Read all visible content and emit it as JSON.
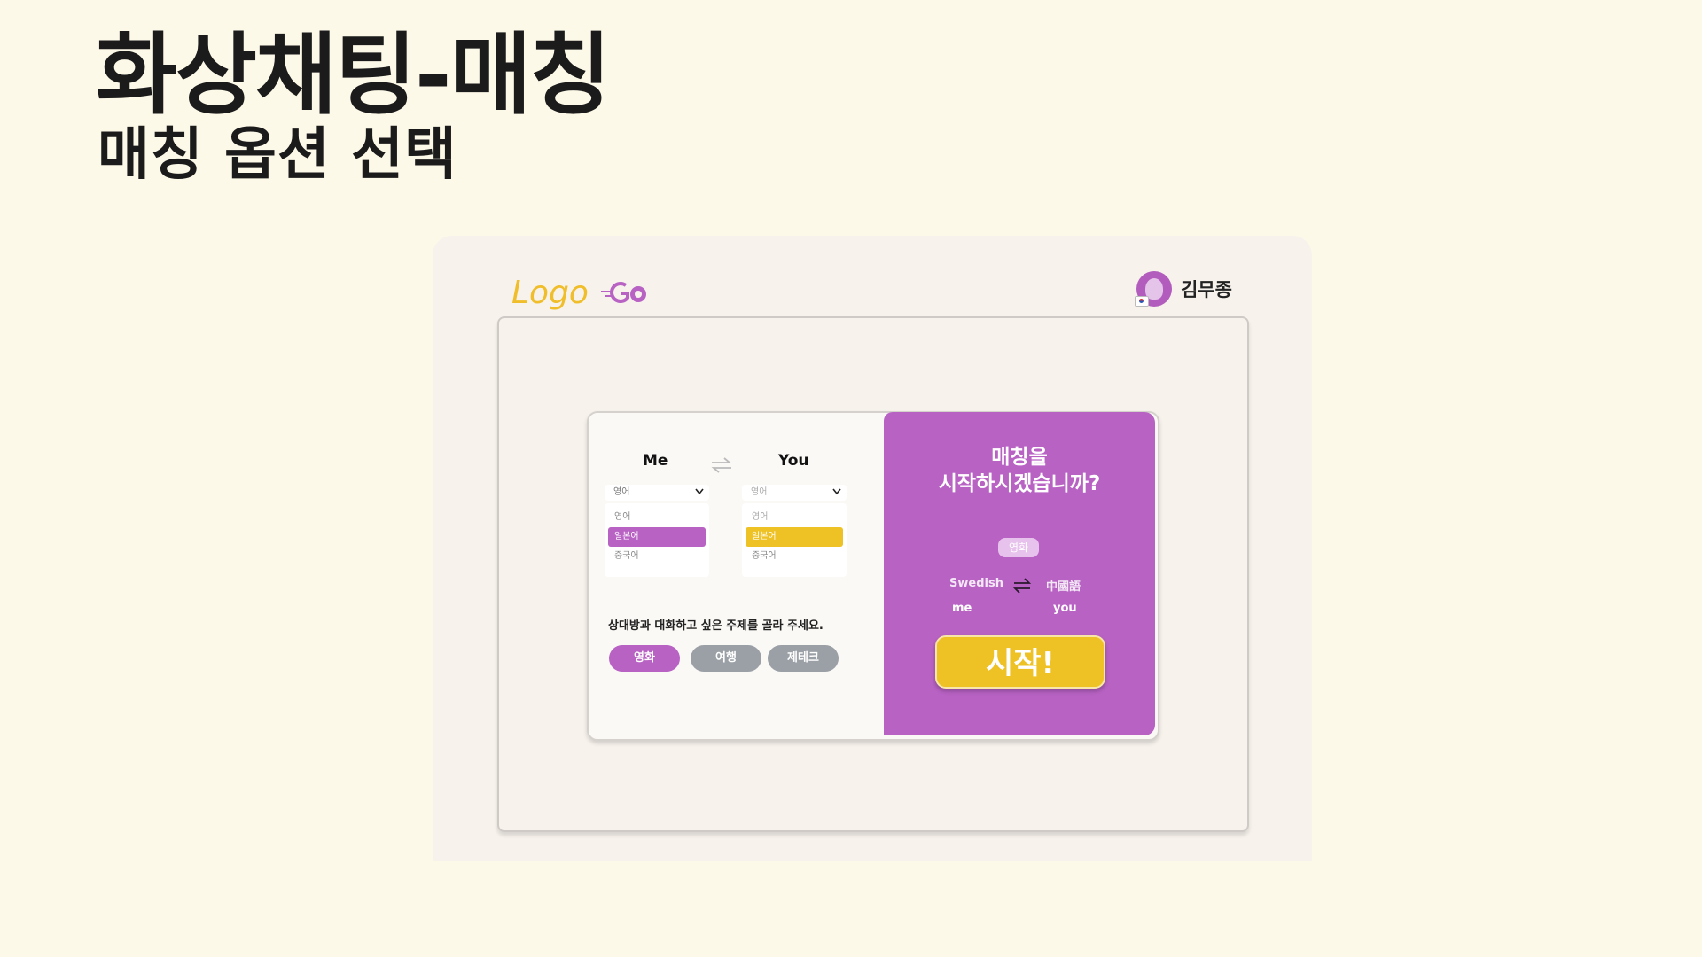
{
  "slide": {
    "title": "화상채팅-매칭",
    "subtitle": "매칭 옵션 선택"
  },
  "header": {
    "logo_text": "Logo",
    "logo_icon": "go-logo-icon",
    "user_name": "김무종",
    "avatar_icon": "user-avatar-icon"
  },
  "matching": {
    "me_label": "Me",
    "you_label": "You",
    "me_select": {
      "value": "영어",
      "options": [
        "영어",
        "일본어",
        "중국어"
      ],
      "highlighted": "일본어"
    },
    "you_select": {
      "value": "영어",
      "options": [
        "영어",
        "일본어",
        "중국어"
      ],
      "highlighted": "일본어"
    },
    "topic_prompt": "상대방과 대화하고 싶은 주제를 골라 주세요.",
    "topics": [
      {
        "label": "영화",
        "active": true
      },
      {
        "label": "여행",
        "active": false
      },
      {
        "label": "제테크",
        "active": false
      }
    ]
  },
  "panel": {
    "title_line1": "매칭을",
    "title_line2": "시작하시겠습니까?",
    "selected_topic": "영화",
    "me_language": "Swedish",
    "you_language": "中國語",
    "me_role": "me",
    "you_role": "you",
    "start_label": "시작!"
  },
  "colors": {
    "background": "#fdf9e8",
    "purple": "#b862c4",
    "yellow": "#eec124",
    "gray_chip": "#9aa0a6"
  }
}
